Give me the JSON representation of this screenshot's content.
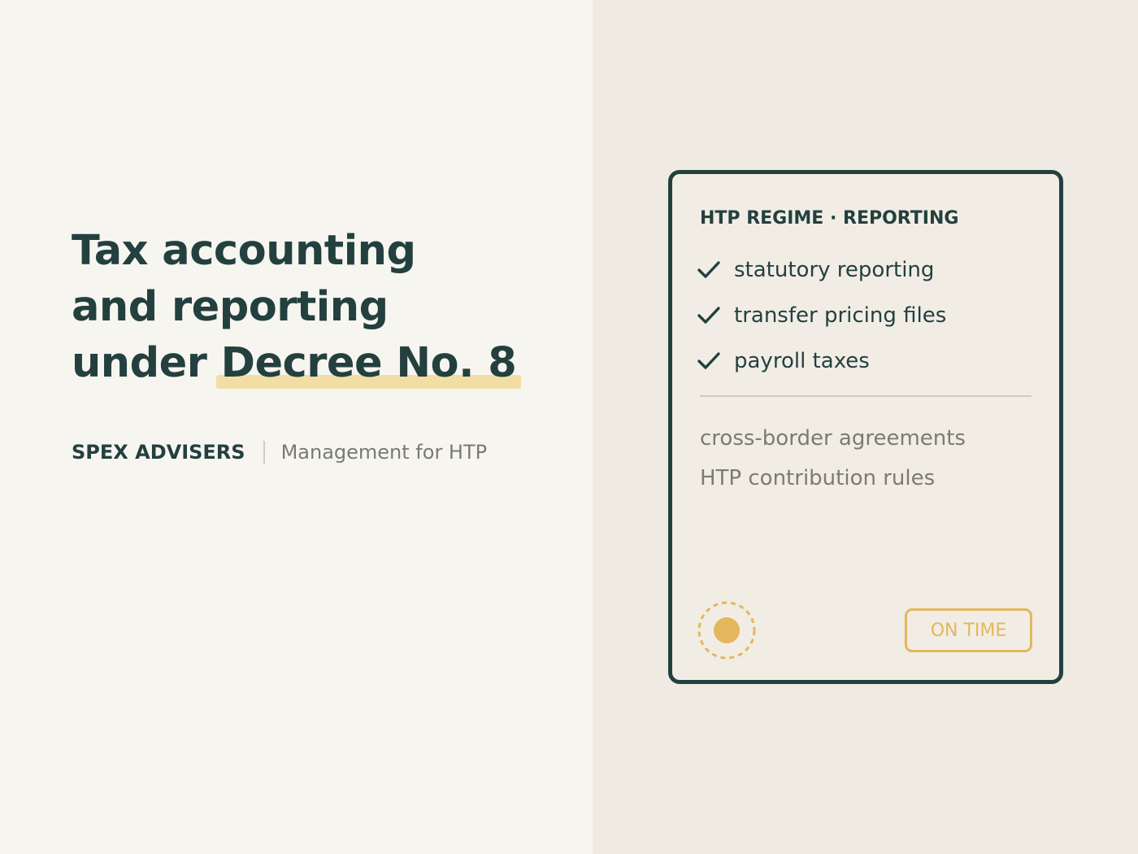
{
  "headline": {
    "line1": "Tax accounting",
    "line2": "and reporting",
    "line3_prefix": "under ",
    "line3_highlight": "Decree No. 8"
  },
  "byline": {
    "brand": "SPEX ADVISERS",
    "tagline": "Management for HTP"
  },
  "card": {
    "title": "HTP REGIME · REPORTING",
    "checklist": [
      "statutory reporting",
      "transfer pricing files",
      "payroll taxes"
    ],
    "secondary": [
      "cross-border agreements",
      "HTP contribution rules"
    ],
    "status_badge": "ON TIME"
  },
  "icons": {
    "check": "check-icon",
    "status": "status-dot-icon"
  },
  "colors": {
    "primary": "#23403f",
    "accent": "#e4b75c",
    "highlight": "#f2dea5",
    "muted_text": "#7b7b74",
    "left_bg": "#f7f5f0",
    "right_bg": "#efebe3"
  }
}
